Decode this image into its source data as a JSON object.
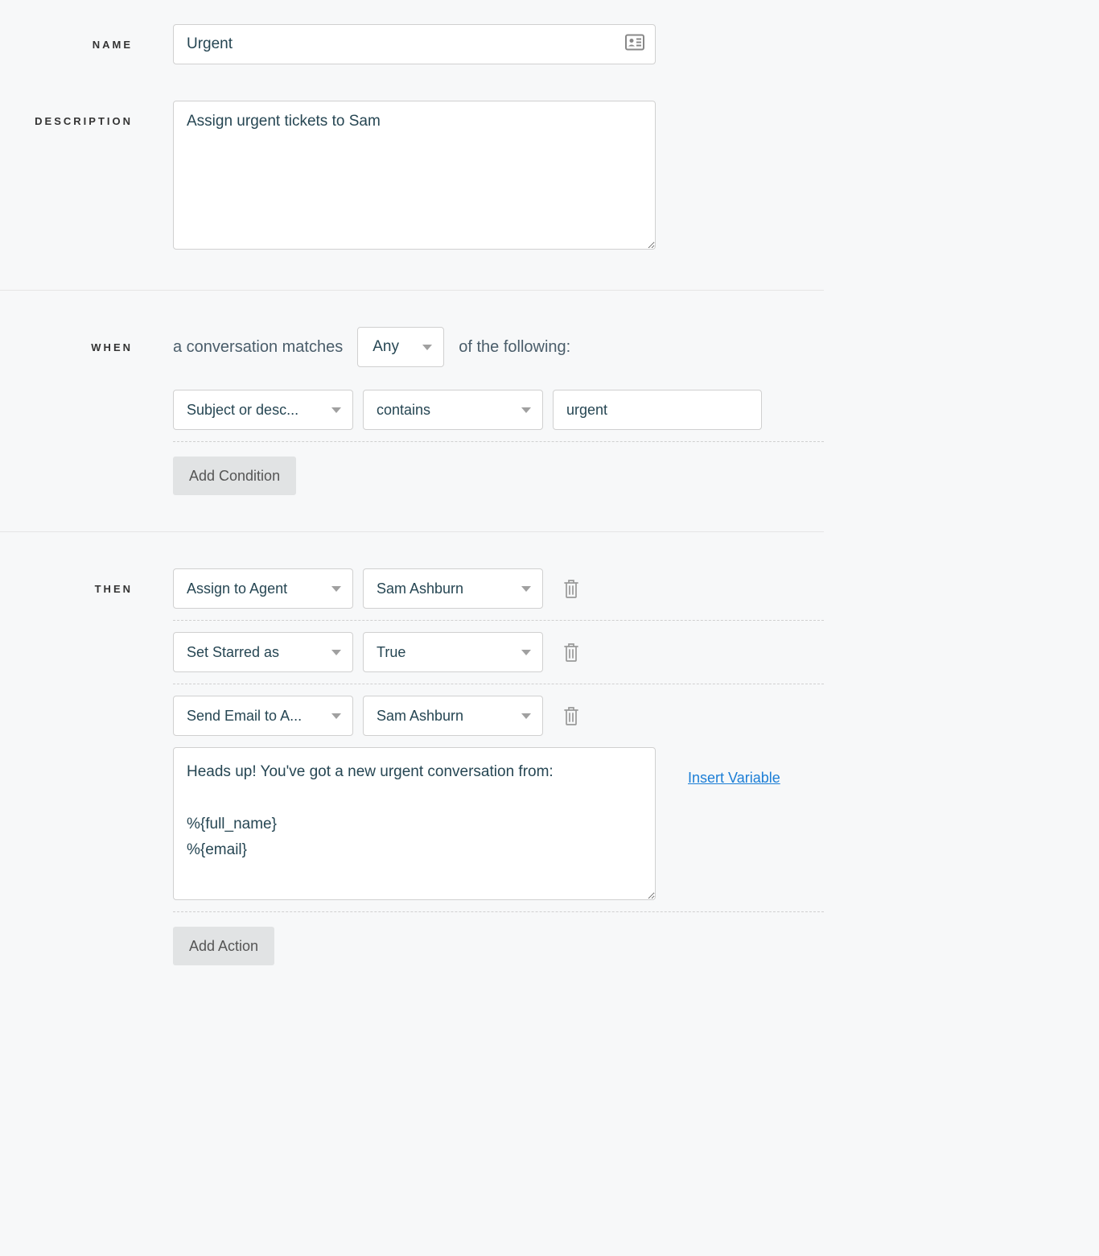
{
  "labels": {
    "name": "NAME",
    "description": "DESCRIPTION",
    "when": "WHEN",
    "then": "THEN"
  },
  "form": {
    "name_value": "Urgent",
    "description_value": "Assign urgent tickets to Sam"
  },
  "when_section": {
    "prefix_text": "a conversation matches",
    "match_type": "Any",
    "suffix_text": "of the following:",
    "conditions": [
      {
        "field": "Subject or desc...",
        "operator": "contains",
        "value": "urgent"
      }
    ],
    "add_button": "Add Condition"
  },
  "then_section": {
    "actions": [
      {
        "type": "Assign to Agent",
        "value": "Sam Ashburn"
      },
      {
        "type": "Set Starred as",
        "value": "True"
      },
      {
        "type": "Send Email to A...",
        "value": "Sam Ashburn"
      }
    ],
    "email_body": "Heads up! You've got a new urgent conversation from:\n\n%{full_name}\n%{email}",
    "insert_variable": "Insert Variable",
    "add_button": "Add Action"
  }
}
